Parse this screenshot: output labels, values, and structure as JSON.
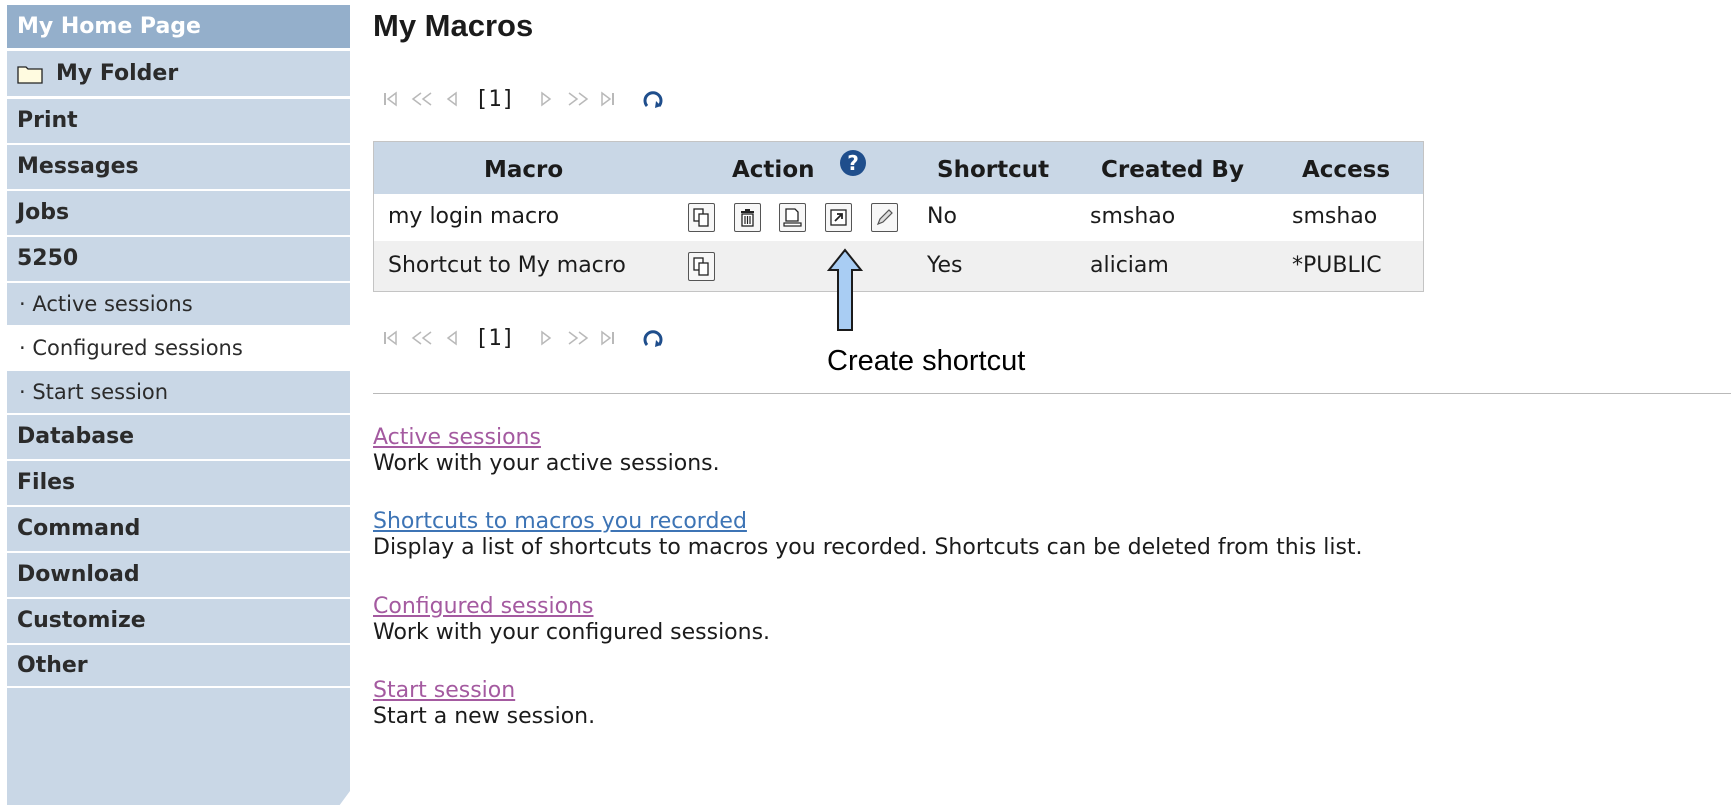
{
  "sidebar": {
    "items": [
      {
        "label": "My Home Page"
      },
      {
        "label": "My Folder"
      },
      {
        "label": "Print"
      },
      {
        "label": "Messages"
      },
      {
        "label": "Jobs"
      },
      {
        "label": "5250"
      },
      {
        "label": "· Active sessions"
      },
      {
        "label": "· Configured sessions"
      },
      {
        "label": "· Start session"
      },
      {
        "label": "Database"
      },
      {
        "label": "Files"
      },
      {
        "label": "Command"
      },
      {
        "label": "Download"
      },
      {
        "label": "Customize"
      },
      {
        "label": "Other"
      }
    ]
  },
  "main": {
    "title": "My Macros",
    "pager": {
      "current_page": "[1]"
    },
    "table": {
      "columns": [
        "Macro",
        "Action",
        "Shortcut",
        "Created By",
        "Access"
      ],
      "rows": [
        {
          "macro": "my login macro",
          "shortcut": "No",
          "created_by": "smshao",
          "access": "smshao",
          "actions": [
            "copy-icon",
            "delete-icon",
            "rename-icon",
            "create-shortcut-icon",
            "edit-icon"
          ]
        },
        {
          "macro": "Shortcut to My macro",
          "shortcut": "Yes",
          "created_by": "aliciam",
          "access": "*PUBLIC",
          "actions": [
            "copy-icon"
          ]
        }
      ]
    },
    "annotation": {
      "label": "Create shortcut"
    },
    "links": [
      {
        "title": "Active sessions",
        "desc": "Work with your active sessions.",
        "visited": true
      },
      {
        "title": "Shortcuts to macros you recorded",
        "desc": "Display a list of shortcuts to macros you recorded. Shortcuts can be deleted from this list.",
        "visited": false
      },
      {
        "title": "Configured sessions",
        "desc": "Work with your configured sessions.",
        "visited": true
      },
      {
        "title": "Start session",
        "desc": "Start a new session.",
        "visited": true
      }
    ]
  },
  "colors": {
    "sidebar_bg": "#c9d7e6",
    "sidebar_active": "#94afcb",
    "visited_link": "#a45aa0",
    "link": "#3d74b5"
  }
}
